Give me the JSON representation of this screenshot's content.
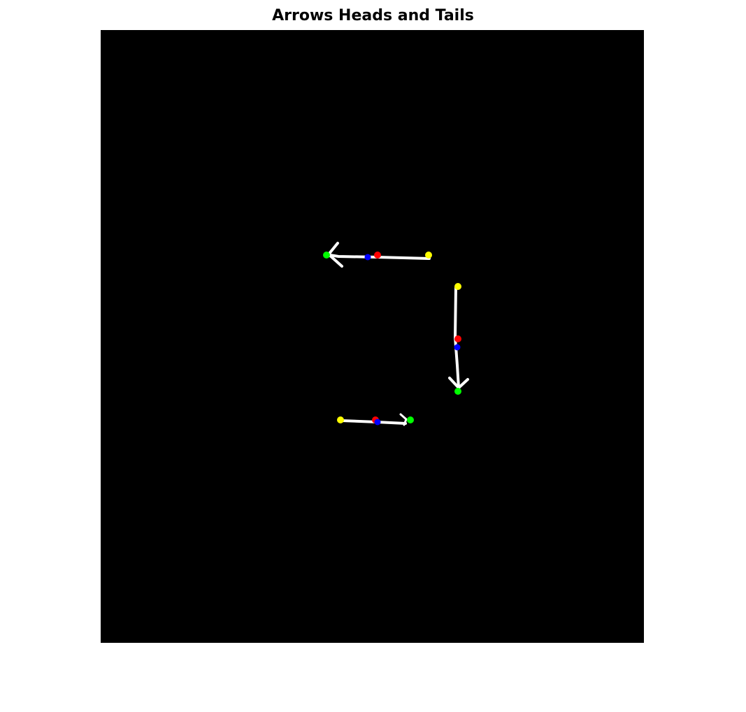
{
  "title": "Arrows Heads and Tails",
  "colors": {
    "background": "#000000",
    "arrow": "#ffffff",
    "tail_marker": "#ffff00",
    "head_marker": "#00ff00",
    "center_marker": "#ff0000",
    "centroid_marker": "#0000ff"
  }
}
